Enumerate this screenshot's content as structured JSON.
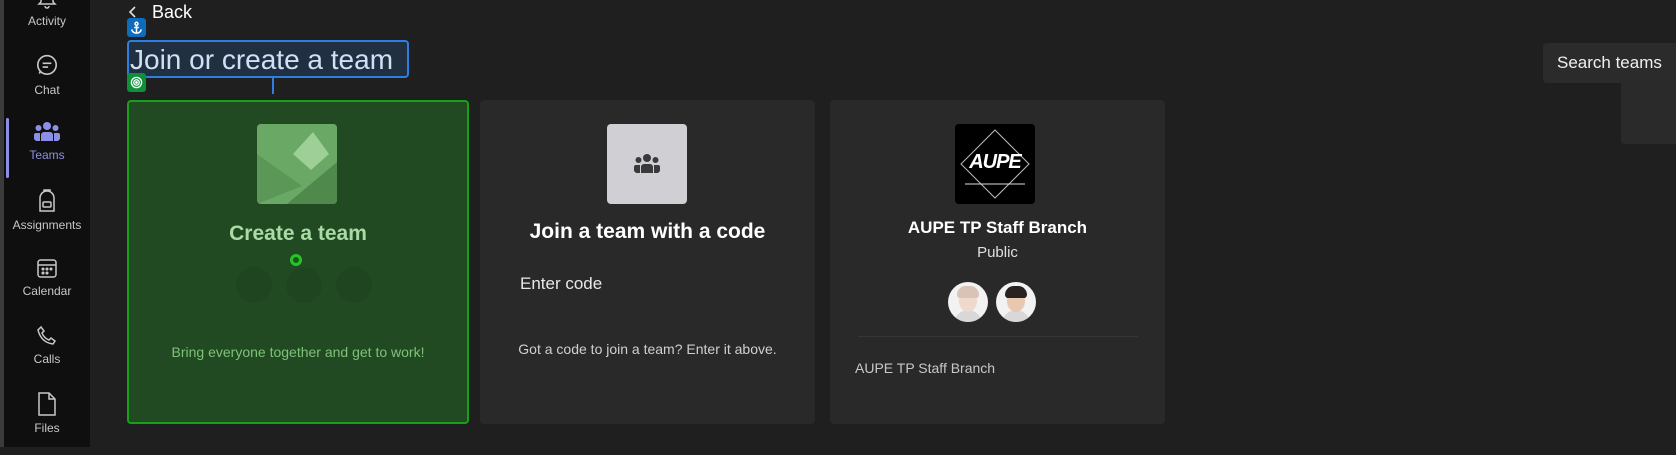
{
  "rail": {
    "items": [
      {
        "label": "Activity",
        "icon": "bell-icon"
      },
      {
        "label": "Chat",
        "icon": "chat-icon"
      },
      {
        "label": "Teams",
        "icon": "teams-icon",
        "active": true
      },
      {
        "label": "Assignments",
        "icon": "backpack-icon"
      },
      {
        "label": "Calendar",
        "icon": "calendar-icon"
      },
      {
        "label": "Calls",
        "icon": "phone-icon"
      },
      {
        "label": "Files",
        "icon": "file-icon"
      }
    ],
    "accent_color": "#8b8fe6"
  },
  "header": {
    "back_label": "Back",
    "title": "Join or create a team",
    "search_placeholder": "Search teams"
  },
  "cards": {
    "create": {
      "title": "Create a team",
      "description": "Bring everyone together and get to work!",
      "accent_color": "#17a11a"
    },
    "join": {
      "title": "Join a team with a code",
      "input_placeholder": "Enter code",
      "description": "Got a code to join a team? Enter it above."
    },
    "team": {
      "logo_text": "AUPE",
      "name": "AUPE TP Staff Branch",
      "visibility": "Public",
      "description": "AUPE TP Staff Branch"
    }
  }
}
